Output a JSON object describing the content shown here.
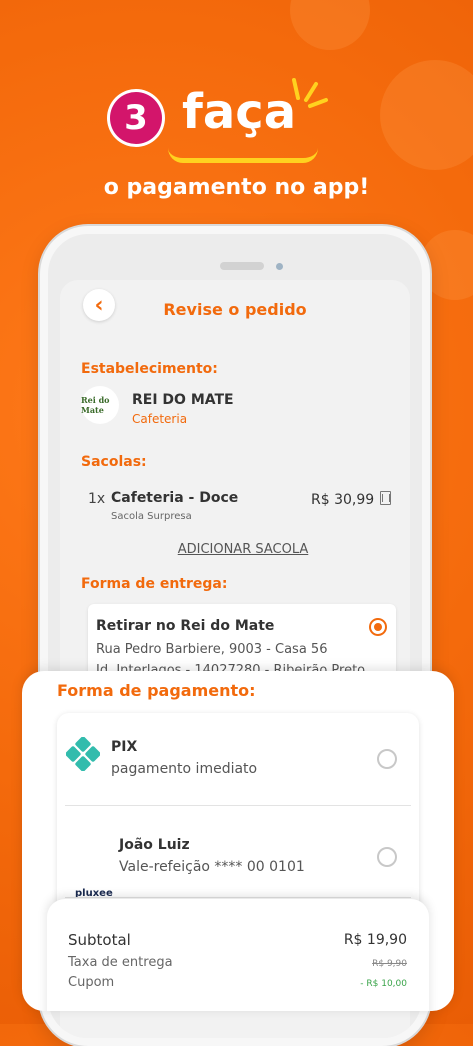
{
  "header": {
    "step_number": "3",
    "step_word": "faça",
    "step_subtitle": "o pagamento no app!"
  },
  "screen": {
    "title": "Revise o pedido",
    "back_icon": "chevron-left-icon",
    "establishment": {
      "label": "Estabelecimento:",
      "logo_text": "Rei do Mate",
      "name": "REI DO MATE",
      "category": "Cafeteria"
    },
    "bags": {
      "label": "Sacolas:",
      "items": [
        {
          "qty": "1x",
          "name": "Cafeteria - Doce",
          "subtitle": "Sacola Surpresa",
          "price": "R$ 30,99"
        }
      ],
      "add_label": "ADICIONAR SACOLA"
    },
    "delivery": {
      "label": "Forma de entrega:",
      "option_title": "Retirar no Rei do Mate",
      "address_line1": "Rua Pedro Barbiere, 9003 - Casa 56",
      "address_line2": "Jd. Interlagos - 14027280 - Ribeirão Preto"
    }
  },
  "payment": {
    "title": "Forma de pagamento:",
    "methods": [
      {
        "name": "PIX",
        "description": "pagamento imediato",
        "icon": "pix-icon"
      },
      {
        "name": "João Luiz",
        "description": "Vale-refeição **** 00 0101",
        "brand": "pluxee"
      }
    ]
  },
  "summary": {
    "subtotal_label": "Subtotal",
    "subtotal_value": "R$ 19,90",
    "delivery_fee_label": "Taxa de entrega",
    "delivery_fee_value": "R$ 9,90",
    "coupon_label": "Cupom",
    "coupon_value": "- R$ 10,00"
  },
  "colors": {
    "brand_orange": "#f26a0d",
    "badge_pink": "#d3156b",
    "accent_yellow": "#ffd21f",
    "pix_teal": "#32bcad"
  }
}
